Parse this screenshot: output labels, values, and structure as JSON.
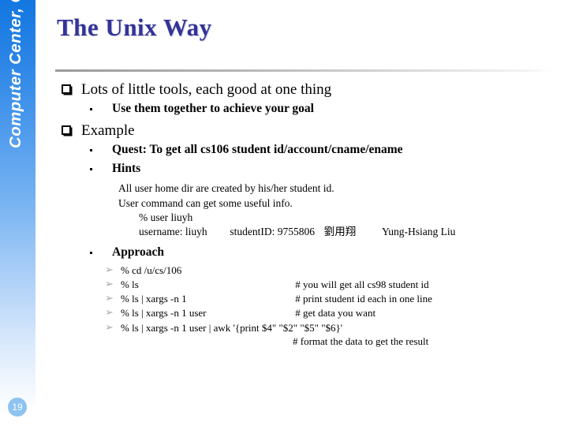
{
  "sidebar": {
    "label": "Computer Center, CS, NCTU",
    "page_number": "19",
    "accent_top": "#1277e0",
    "badge_color": "#8cc3f0"
  },
  "slide": {
    "title": "The Unix Way",
    "title_color": "#333399"
  },
  "content": {
    "b1": "Lots of little tools, each good at one thing",
    "b1_sub1": "Use them together to achieve your goal",
    "b2": "Example",
    "b2_sub1": "Quest: To get all cs106 student id/account/cname/ename",
    "b2_sub2": "Hints",
    "hint1": "All user home dir are created by his/her student id.",
    "hint2": "User command can get some useful info.",
    "hint3": "% user liuyh",
    "hint4_user": "username: liuyh",
    "hint4_id": "studentID: 9755806",
    "hint4_cname": "劉用翔",
    "hint4_ename": "Yung-Hsiang Liu",
    "b2_sub3": "Approach",
    "steps": [
      {
        "bullet": "➢",
        "cmd": "% cd /u/cs/106",
        "comment": ""
      },
      {
        "bullet": "➢",
        "cmd": "% ls",
        "comment": "# you will get all cs98 student id"
      },
      {
        "bullet": "➢",
        "cmd": "% ls | xargs -n 1",
        "comment": "# print student id each in one line"
      },
      {
        "bullet": "➢",
        "cmd": "% ls | xargs -n 1 user",
        "comment": "# get data you want"
      },
      {
        "bullet": "➢",
        "cmd": "% ls | xargs -n 1 user | awk '{print $4\" \"$2\" \"$5\" \"$6}'",
        "comment": ""
      }
    ],
    "final_comment": "# format the data to get the result"
  }
}
